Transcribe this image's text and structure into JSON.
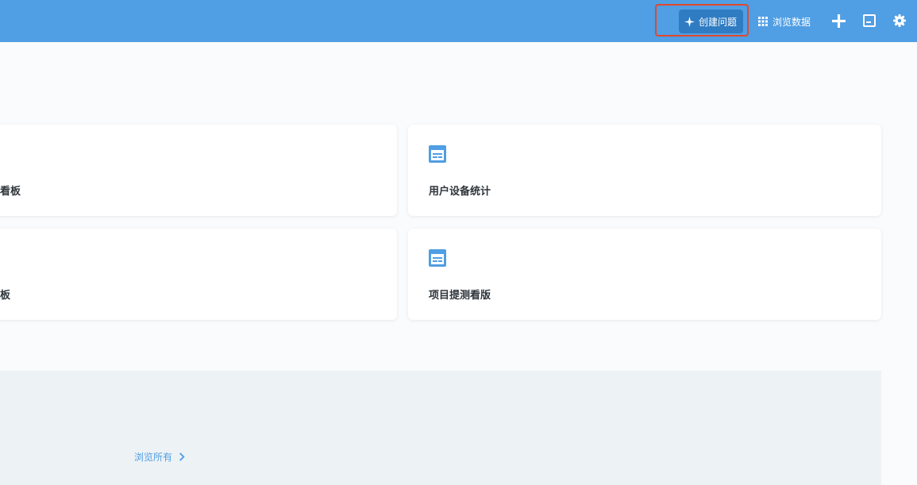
{
  "header": {
    "create_question_label": "创建问题",
    "browse_data_label": "浏览数据",
    "icons": [
      "sparkle-icon",
      "grid-icon",
      "plus-icon",
      "terminal-icon",
      "gear-icon"
    ]
  },
  "dashboards": [
    {
      "title": "看板",
      "icon": "dashboard-icon"
    },
    {
      "title": "用户设备统计",
      "icon": "dashboard-icon"
    },
    {
      "title": "板",
      "icon": "dashboard-icon"
    },
    {
      "title": "项目提测看版",
      "icon": "dashboard-icon"
    }
  ],
  "collections": {
    "browse_all_label": "浏览所有"
  },
  "colors": {
    "brand": "#509ee3",
    "button": "#2f7cc3",
    "highlight": "#e2482c",
    "background": "#f9fbfc",
    "section": "#edf2f5"
  }
}
